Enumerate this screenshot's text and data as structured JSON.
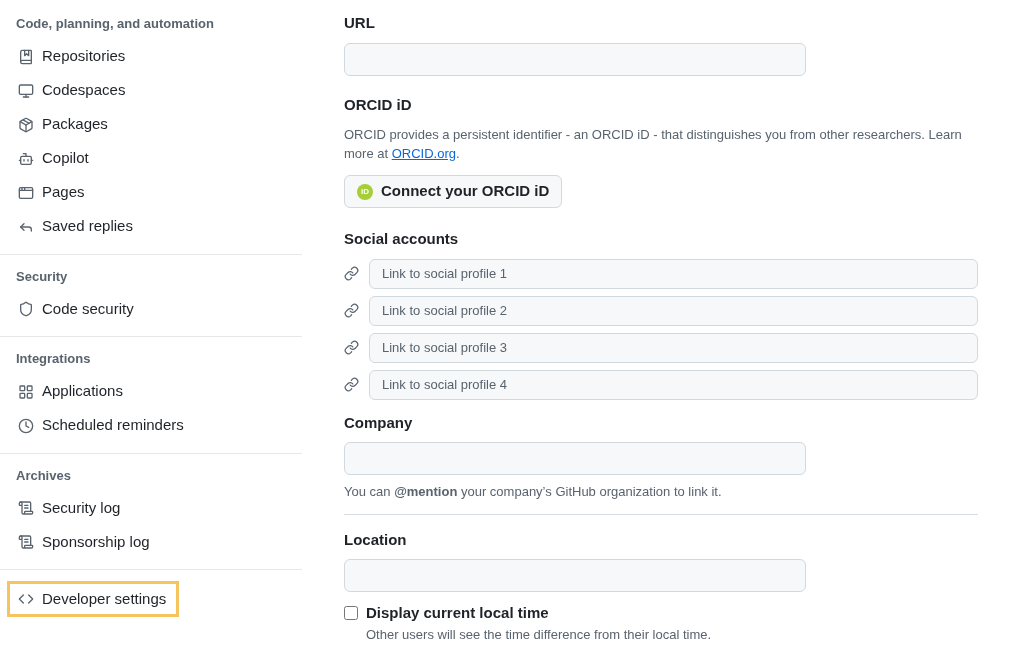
{
  "sidebar": {
    "sections": [
      {
        "heading": "Code, planning, and automation",
        "items": [
          {
            "label": "Repositories",
            "highlighted": false
          },
          {
            "label": "Codespaces",
            "highlighted": false
          },
          {
            "label": "Packages",
            "highlighted": false
          },
          {
            "label": "Copilot",
            "highlighted": false
          },
          {
            "label": "Pages",
            "highlighted": false
          },
          {
            "label": "Saved replies",
            "highlighted": false
          }
        ]
      },
      {
        "heading": "Security",
        "items": [
          {
            "label": "Code security",
            "highlighted": false
          }
        ]
      },
      {
        "heading": "Integrations",
        "items": [
          {
            "label": "Applications",
            "highlighted": false
          },
          {
            "label": "Scheduled reminders",
            "highlighted": false
          }
        ]
      },
      {
        "heading": "Archives",
        "items": [
          {
            "label": "Security log",
            "highlighted": false
          },
          {
            "label": "Sponsorship log",
            "highlighted": false
          }
        ]
      },
      {
        "items": [
          {
            "label": "Developer settings",
            "highlighted": true
          }
        ]
      }
    ]
  },
  "form": {
    "url": {
      "label": "URL"
    },
    "orcid": {
      "label": "ORCID iD",
      "description": "ORCID provides a persistent identifier - an ORCID iD - that distinguishes you from other researchers. Learn more at ",
      "link": "ORCID.org",
      "description_end": ".",
      "button": "Connect your ORCID iD",
      "badge": "iD"
    },
    "social": {
      "label": "Social accounts",
      "links": [
        {
          "placeholder": "Link to social profile 1"
        },
        {
          "placeholder": "Link to social profile 2"
        },
        {
          "placeholder": "Link to social profile 3"
        },
        {
          "placeholder": "Link to social profile 4"
        }
      ]
    },
    "company": {
      "label": "Company",
      "help": "You can **@mention** your company’s GitHub organization to link it."
    },
    "location": {
      "label": "Location"
    },
    "local_time": {
      "label": "Display current local time",
      "checked": false,
      "help": "Other users will see the time difference from their local time."
    }
  }
}
